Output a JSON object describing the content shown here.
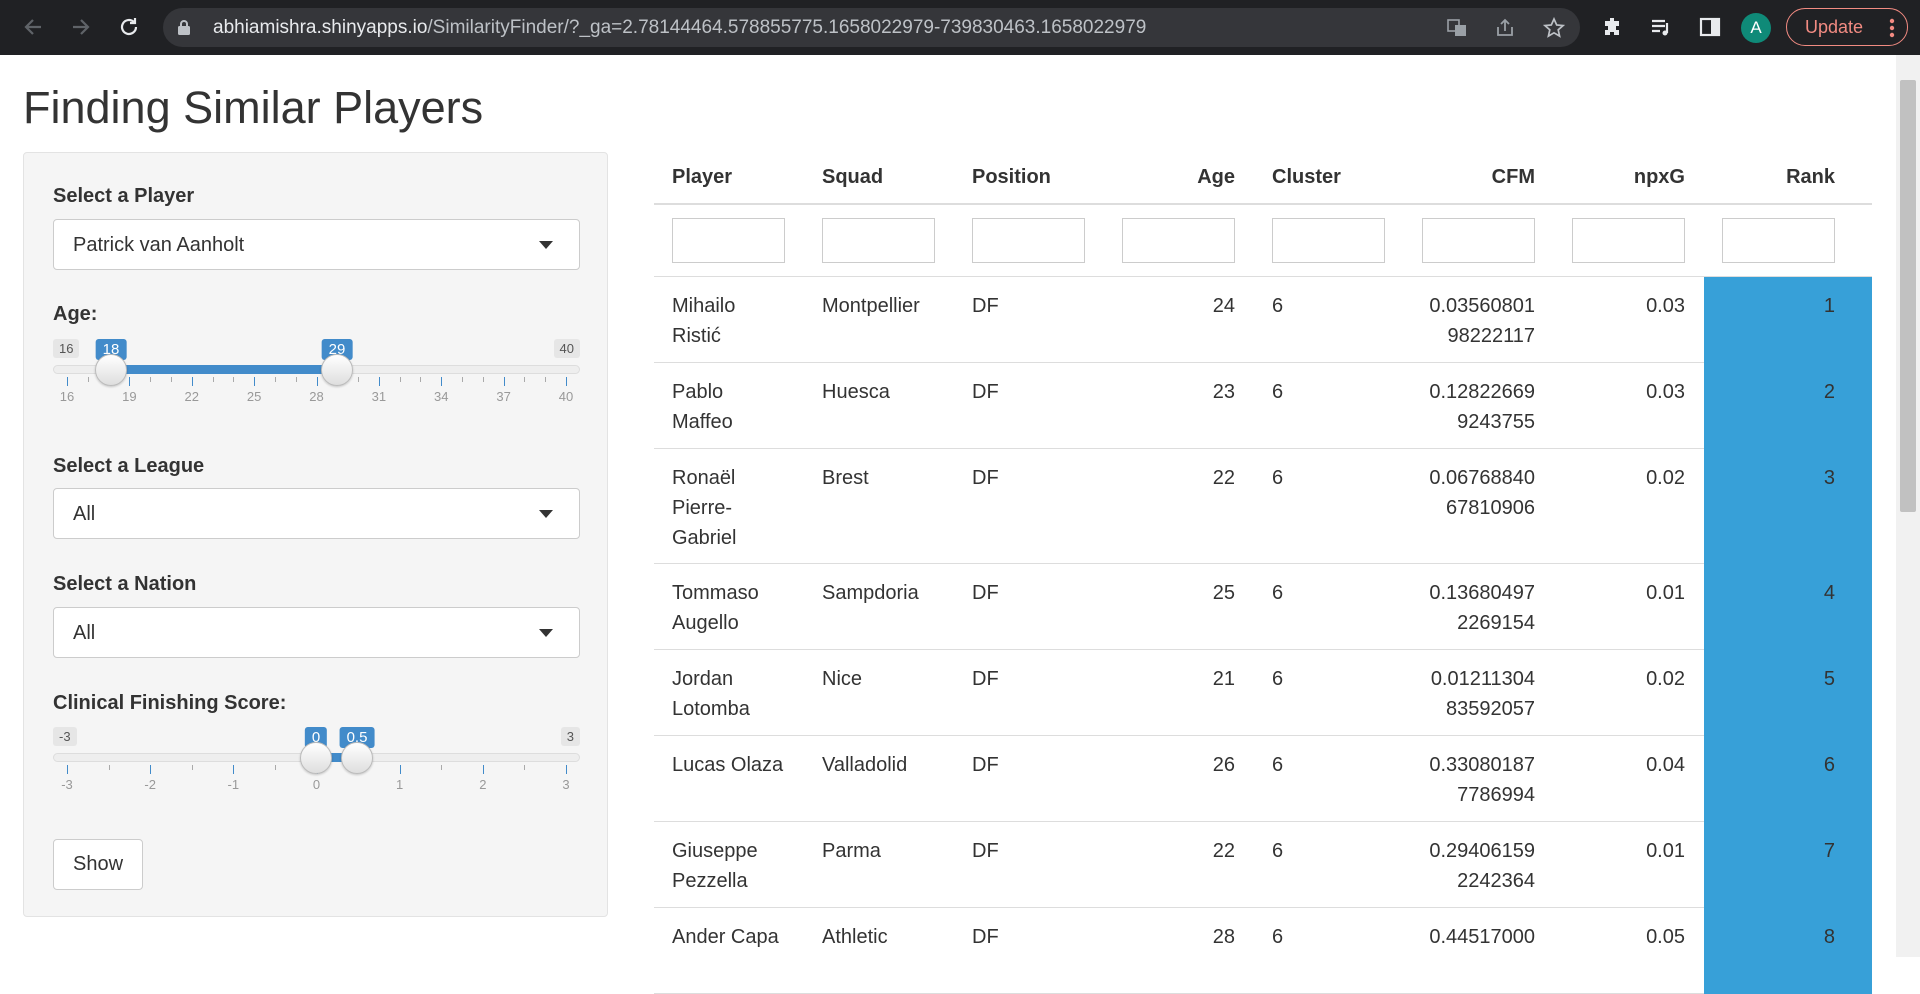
{
  "browser": {
    "url_host": "abhiamishra.shinyapps.io",
    "url_path": "/SimilarityFinder/?_ga=2.78144464.578855775.1658022979-739830463.1658022979",
    "profile_initial": "A",
    "update_label": "Update"
  },
  "page": {
    "title": "Finding Similar Players"
  },
  "sidebar": {
    "player_label": "Select a Player",
    "player_value": "Patrick van Aanholt",
    "age_label": "Age:",
    "age_slider": {
      "min": "16",
      "max": "40",
      "from": "18",
      "to": "29",
      "ticks": [
        "16",
        "19",
        "22",
        "25",
        "28",
        "31",
        "34",
        "37",
        "40"
      ]
    },
    "league_label": "Select a League",
    "league_value": "All",
    "nation_label": "Select a Nation",
    "nation_value": "All",
    "cfs_label": "Clinical Finishing Score:",
    "cfs_slider": {
      "min": "-3",
      "max": "3",
      "from": "0",
      "to": "0.5",
      "ticks": [
        "-3",
        "-2",
        "-1",
        "0",
        "1",
        "2",
        "3"
      ]
    },
    "show_button": "Show"
  },
  "table": {
    "columns": [
      "Player",
      "Squad",
      "Position",
      "Age",
      "Cluster",
      "CFM",
      "npxG",
      "Rank"
    ],
    "rows": [
      {
        "player": [
          "Mihailo",
          "Ristić"
        ],
        "squad": [
          "Montpellier"
        ],
        "position": "DF",
        "age": "24",
        "cluster": "6",
        "cfm": [
          "0.03560801",
          "98222117"
        ],
        "npxg": "0.03",
        "rank": "1"
      },
      {
        "player": [
          "Pablo",
          "Maffeo"
        ],
        "squad": [
          "Huesca"
        ],
        "position": "DF",
        "age": "23",
        "cluster": "6",
        "cfm": [
          "0.12822669",
          "9243755"
        ],
        "npxg": "0.03",
        "rank": "2"
      },
      {
        "player": [
          "Ronaël",
          "Pierre-",
          "Gabriel"
        ],
        "squad": [
          "Brest"
        ],
        "position": "DF",
        "age": "22",
        "cluster": "6",
        "cfm": [
          "0.06768840",
          "67810906"
        ],
        "npxg": "0.02",
        "rank": "3"
      },
      {
        "player": [
          "Tommaso",
          "Augello"
        ],
        "squad": [
          "Sampdoria"
        ],
        "position": "DF",
        "age": "25",
        "cluster": "6",
        "cfm": [
          "0.13680497",
          "2269154"
        ],
        "npxg": "0.01",
        "rank": "4"
      },
      {
        "player": [
          "Jordan",
          "Lotomba"
        ],
        "squad": [
          "Nice"
        ],
        "position": "DF",
        "age": "21",
        "cluster": "6",
        "cfm": [
          "0.01211304",
          "83592057"
        ],
        "npxg": "0.02",
        "rank": "5"
      },
      {
        "player": [
          "Lucas Olaza"
        ],
        "squad": [
          "Valladolid"
        ],
        "position": "DF",
        "age": "26",
        "cluster": "6",
        "cfm": [
          "0.33080187",
          "7786994"
        ],
        "npxg": "0.04",
        "rank": "6"
      },
      {
        "player": [
          "Giuseppe",
          "Pezzella"
        ],
        "squad": [
          "Parma"
        ],
        "position": "DF",
        "age": "22",
        "cluster": "6",
        "cfm": [
          "0.29406159",
          "2242364"
        ],
        "npxg": "0.01",
        "rank": "7"
      },
      {
        "player": [
          "Ander Capa"
        ],
        "squad": [
          "Athletic"
        ],
        "position": "DF",
        "age": "28",
        "cluster": "6",
        "cfm": [
          "0.44517000"
        ],
        "npxg": "0.05",
        "rank": "8"
      }
    ]
  },
  "colors": {
    "accent": "#428bca",
    "rank_bar": "#37a0d8",
    "chrome_bg": "#202124"
  }
}
